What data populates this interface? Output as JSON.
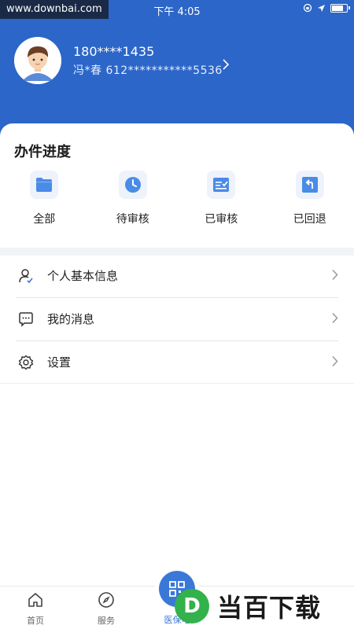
{
  "status_bar": {
    "watermark": "www.downbai.com",
    "time": "下午 4:05",
    "battery_level": 0.8
  },
  "profile": {
    "phone": "180****1435",
    "id_line": "冯*春 612***********5536"
  },
  "progress": {
    "title": "办件进度",
    "items": [
      {
        "label": "全部",
        "icon": "folder-icon"
      },
      {
        "label": "待审核",
        "icon": "clock-icon"
      },
      {
        "label": "已审核",
        "icon": "reviewed-document-icon"
      },
      {
        "label": "已回退",
        "icon": "return-arrow-icon"
      }
    ]
  },
  "menu": [
    {
      "label": "个人基本信息",
      "icon": "user-check-icon"
    },
    {
      "label": "我的消息",
      "icon": "message-icon"
    },
    {
      "label": "设置",
      "icon": "gear-icon"
    }
  ],
  "bottom_nav": {
    "home": "首页",
    "service": "服务",
    "center": "医保电"
  },
  "watermark_logo": {
    "text": "当百下载",
    "mark": "D"
  },
  "colors": {
    "header_blue": "#2c66c8",
    "accent_blue": "#3a78d8",
    "icon_tile_bg": "#edf2fb",
    "watermark_green": "#33b14b"
  }
}
